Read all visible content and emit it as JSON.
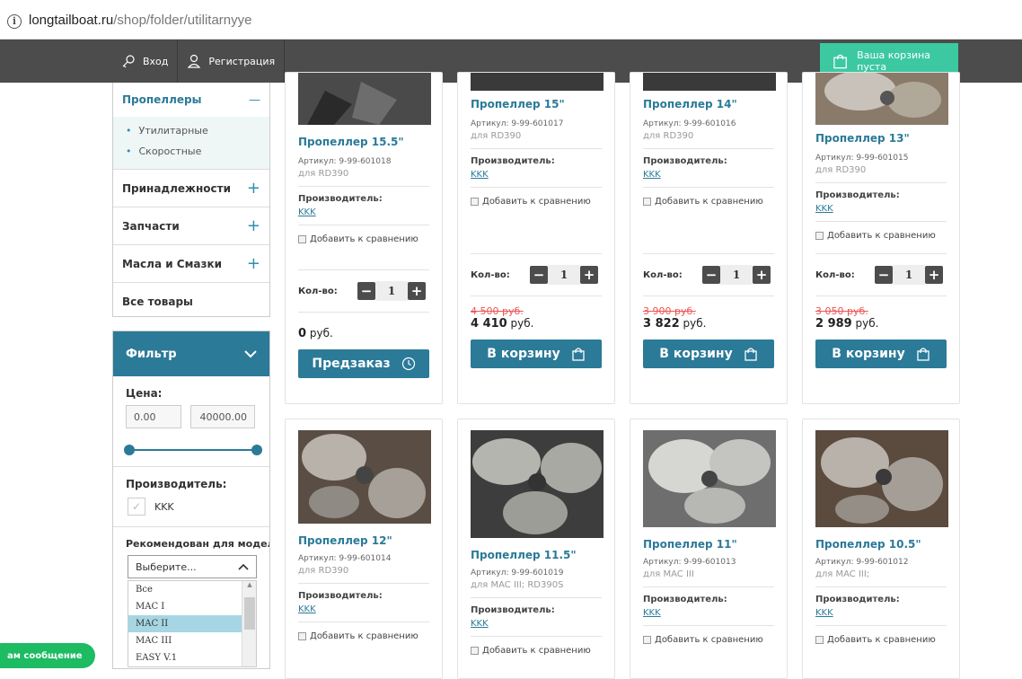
{
  "browser": {
    "url_host": "longtailboat.ru",
    "url_path": "/shop/folder/utilitarnyye"
  },
  "topnav": {
    "login": "Вход",
    "register": "Регистрация",
    "cart": "Ваша корзина пуста"
  },
  "sidebar": {
    "open_category": "Пропеллеры",
    "open_symbol": "—",
    "subcategories": [
      "Утилитарные",
      "Скоростные"
    ],
    "categories": [
      {
        "label": "Принадлежности",
        "symbol": "+"
      },
      {
        "label": "Запчасти",
        "symbol": "+"
      },
      {
        "label": "Масла и Смазки",
        "symbol": "+"
      },
      {
        "label": "Все товары",
        "symbol": ""
      }
    ]
  },
  "filter": {
    "title": "Фильтр",
    "price_label": "Цена:",
    "price_min": "0.00",
    "price_max": "40000.00",
    "maker_label": "Производитель:",
    "maker_option": "KKK",
    "models_label": "Рекомендован для моделей LTB:",
    "models_placeholder": "Выберите...",
    "models_options": [
      "Все",
      "MAC I",
      "MAC II",
      "MAC III",
      "EASY V.1"
    ],
    "models_selected": "MAC II"
  },
  "common": {
    "sku_label": "Артикул:",
    "maker_label": "Производитель:",
    "maker_value": "KKK",
    "compare": "Добавить к сравнению",
    "qty_label": "Кол-во:",
    "qty_value": "1",
    "currency": "руб.",
    "buy": "В корзину",
    "preorder": "Предзаказ"
  },
  "products": [
    {
      "name": "Пропеллер 15.5\"",
      "sku": "9-99-601018",
      "for": "для RD390",
      "old_price": "",
      "price": "0",
      "action": "preorder"
    },
    {
      "name": "Пропеллер 15\"",
      "sku": "9-99-601017",
      "for": "для RD390",
      "old_price": "4 500 руб.",
      "price": "4 410",
      "action": "buy"
    },
    {
      "name": "Пропеллер 14\"",
      "sku": "9-99-601016",
      "for": "для RD390",
      "old_price": "3 900 руб.",
      "price": "3 822",
      "action": "buy"
    },
    {
      "name": "Пропеллер 13\"",
      "sku": "9-99-601015",
      "for": "для RD390",
      "old_price": "3 050 руб.",
      "price": "2 989",
      "action": "buy"
    },
    {
      "name": "Пропеллер 12\"",
      "sku": "9-99-601014",
      "for": "для RD390"
    },
    {
      "name": "Пропеллер 11.5\"",
      "sku": "9-99-601019",
      "for": "для MAC III; RD390S"
    },
    {
      "name": "Пропеллер 11\"",
      "sku": "9-99-601013",
      "for": "для MAC III"
    },
    {
      "name": "Пропеллер 10.5\"",
      "sku": "9-99-601012",
      "for": "для MAC III;"
    }
  ],
  "chat": {
    "label": "ам сообщение"
  },
  "colors": {
    "brand": "#2b7a98",
    "cart": "#3cc9a2",
    "nav": "#4c4c4c",
    "old_price": "#ee5555"
  }
}
